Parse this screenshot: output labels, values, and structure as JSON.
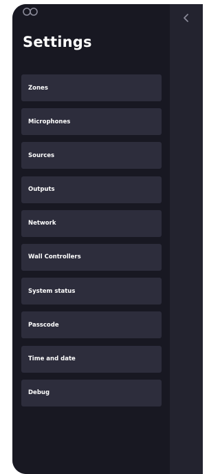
{
  "sidebar": {
    "logo_icon": "infinity-logo-icon",
    "title": "Settings",
    "items": [
      {
        "label": "Zones"
      },
      {
        "label": "Microphones"
      },
      {
        "label": "Sources"
      },
      {
        "label": "Outputs"
      },
      {
        "label": "Network"
      },
      {
        "label": "Wall Controllers"
      },
      {
        "label": "System status"
      },
      {
        "label": "Passcode"
      },
      {
        "label": "Time and date"
      },
      {
        "label": "Debug"
      }
    ]
  },
  "header": {
    "back_icon": "chevron-left-icon"
  },
  "colors": {
    "sidebar_background": "#181822",
    "content_background": "#23232f",
    "item_background": "#2d2d3c",
    "text": "#ffffff",
    "icon": "#8a8a99"
  }
}
